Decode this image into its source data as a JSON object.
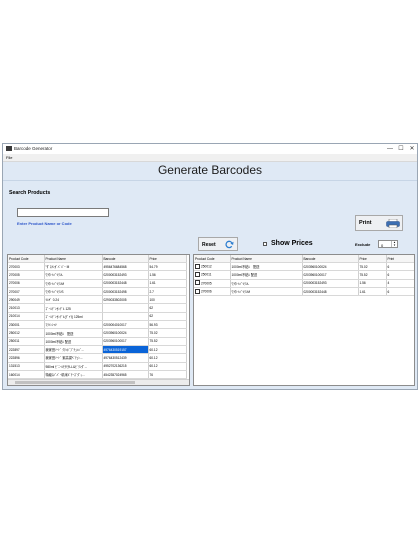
{
  "window": {
    "title": "Barcode Generator",
    "menu": [
      "File"
    ],
    "controls": [
      "—",
      "☐",
      "✕"
    ]
  },
  "page_title": "Generate Barcodes",
  "search": {
    "title": "Search Products",
    "value": "",
    "hint": "Enter Product Name or Code"
  },
  "print_button": "Print",
  "reset_button": "Reset",
  "show_prices": {
    "label": "Show Prices",
    "checked": false
  },
  "exclude": {
    "label": "Exclude",
    "value": "0"
  },
  "left_table": {
    "columns": [
      "Product Code",
      "Product Name",
      "Barcode",
      "Price"
    ],
    "rows": [
      [
        "270003",
        "\"ﾀﾞｽｷﾝｶﾞﾊﾞﾊﾟｰ M",
        "4956476684568",
        "54.79"
      ],
      [
        "270005",
        "ﾜﾗｳﾄﾄﾊﾟﾂｸﾝL",
        "0200003152493",
        "1.56"
      ],
      [
        "270006",
        "ﾜﾗｳﾄﾄﾊﾟﾂｸﾝM",
        "0200003152448",
        "1.61"
      ],
      [
        "270007",
        "ﾜﾗｳﾄﾄﾊﾟﾂｸﾝS",
        "0200003152498",
        "2.7"
      ],
      [
        "290049",
        "ﾂﾙﾔﾞ 0.24",
        "0290033502005",
        "100"
      ],
      [
        "210013",
        "ｺﾞｰﾙﾃﾞﾝｾﾝﾃﾞﾙ 125",
        "",
        "62"
      ],
      [
        "210014",
        "ｺﾞｰﾙﾃﾞﾝｾﾝﾃﾞﾙ(ﾃﾞｲﾗ) 125ml",
        "",
        "62"
      ],
      [
        "230001",
        "ﾏﾗｿﾝｼｬﾂ",
        "0200004010017",
        "56.93"
      ],
      [
        "250012",
        "1000ml不粘ﾙ　配送",
        "0203960100024",
        "75.02"
      ],
      [
        "250011",
        "1000ml不粘ﾙ 配送",
        "0203960100017",
        "75.52"
      ],
      [
        "222897",
        "我家田ｿｰﾄﾞ ｸﾗﾝﾎﾞﾌﾞﾁｭﾝﾊﾞ...",
        "4976430519157",
        "60.12"
      ],
      [
        "222896",
        "我家田ｿｰﾄﾞ 紫高粱ﾍﾞﾁｭﾝ...",
        "4976430512439",
        "60.12"
      ],
      [
        "131513",
        "980ml ﾋﾞﾆｰﾙﾓﾁﾓﾁLL&ﾋﾞｸﾝﾀﾞ...",
        "4952702136215",
        "60.12"
      ],
      [
        "160014",
        "特級ｽﾊﾟﾊﾞｰ精米ﾙﾞﾁｰｽﾞﾀﾞｯ...",
        "4542357024965",
        "76"
      ],
      [
        "100017",
        "...",
        "",
        ""
      ]
    ],
    "selected_row_index": 10
  },
  "right_table": {
    "columns": [
      "Product Code",
      "Product Name",
      "Barcode",
      "Price",
      "Print"
    ],
    "rows": [
      [
        "250012",
        "1000ml不粘ﾙ　配送",
        "0203960100024",
        "75.02",
        "6"
      ],
      [
        "250011",
        "1000ml不粘ﾙ 配送",
        "0203960100017",
        "75.52",
        "6"
      ],
      [
        "270005",
        "ﾜﾗｳﾄﾄﾊﾟﾂｸﾝL",
        "0200003152493",
        "1.56",
        "4"
      ],
      [
        "270006",
        "ﾜﾗｳﾄﾄﾊﾟﾂｸﾝM",
        "0200003152448",
        "1.61",
        "6"
      ]
    ]
  },
  "icons": {
    "app": "barcode-app-icon",
    "printer": "printer-icon",
    "refresh": "refresh-icon"
  }
}
